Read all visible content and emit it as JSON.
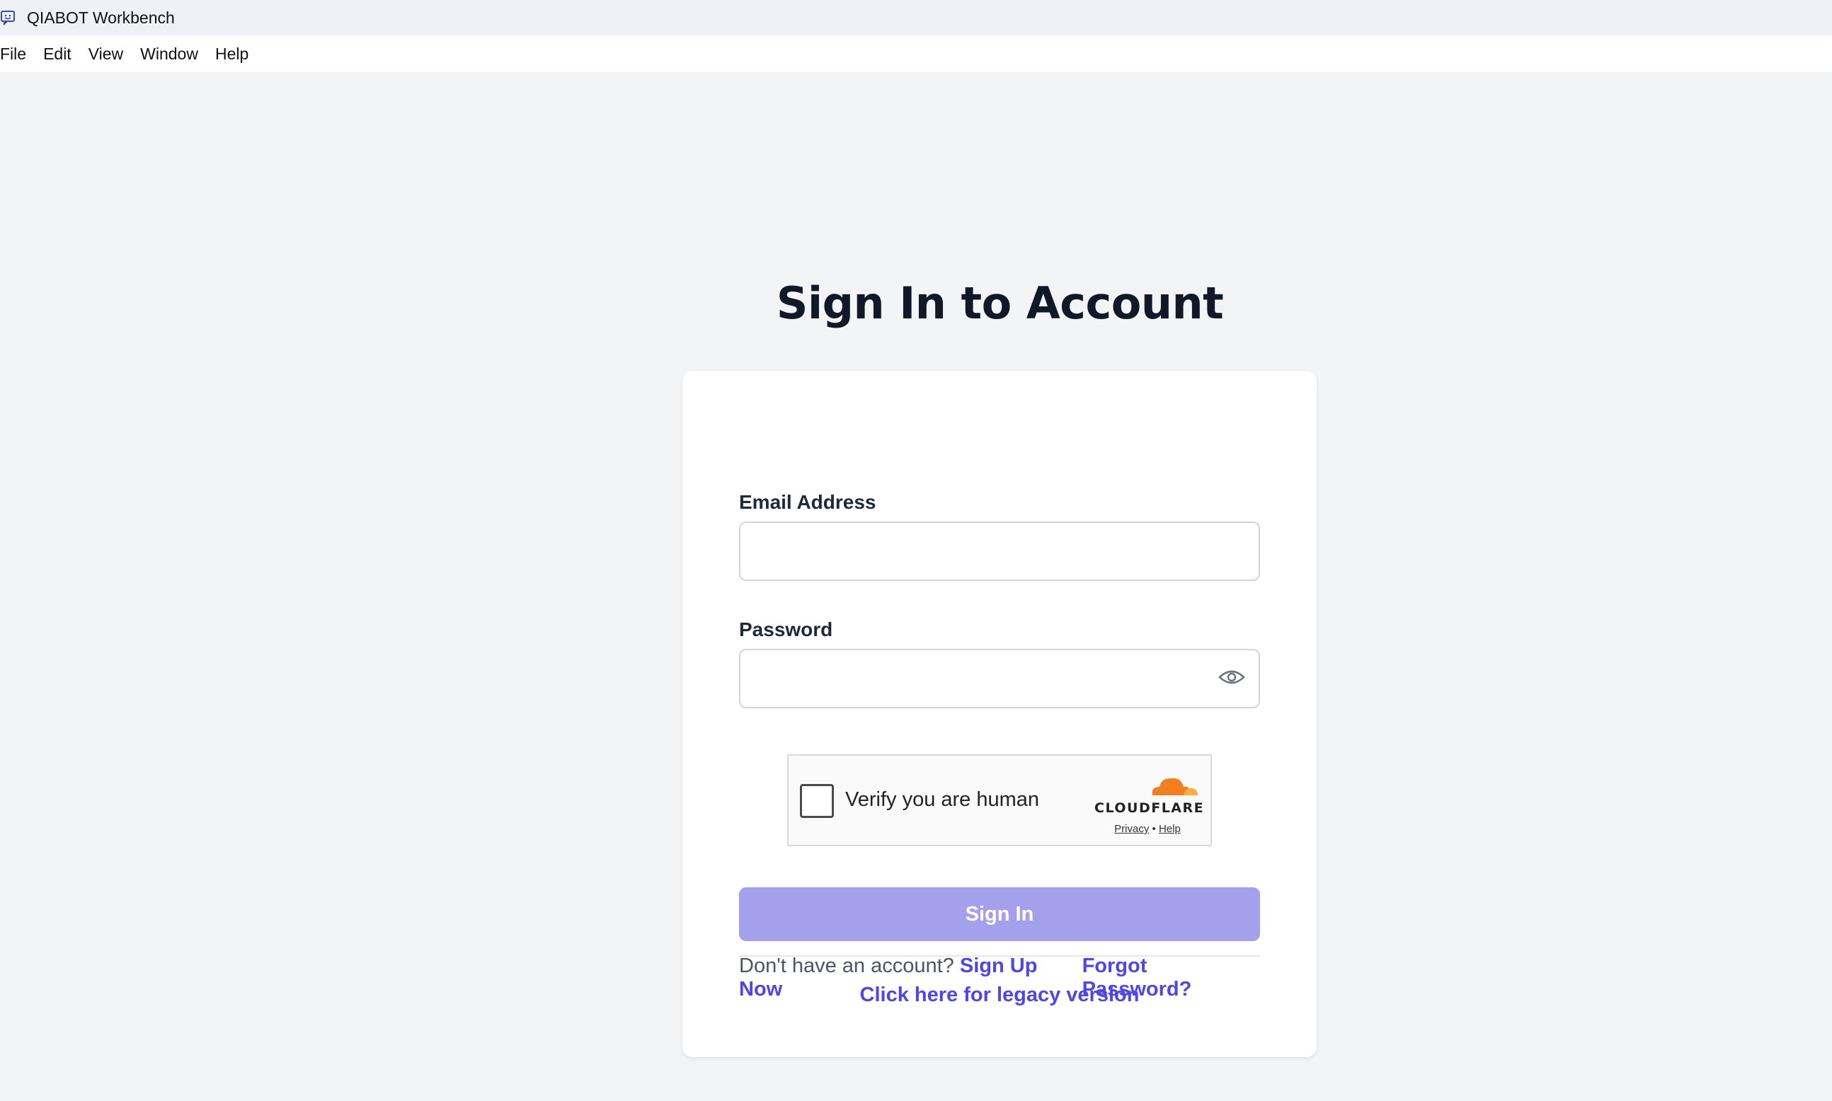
{
  "window": {
    "title": "QIABOT Workbench"
  },
  "menu": {
    "items": [
      "File",
      "Edit",
      "View",
      "Window",
      "Help"
    ]
  },
  "page": {
    "title": "Sign In to Account"
  },
  "form": {
    "email_label": "Email Address",
    "email_value": "",
    "password_label": "Password",
    "password_value": ""
  },
  "captcha": {
    "text": "Verify you are human",
    "brand": "CLOUDFLARE",
    "privacy": "Privacy",
    "separator": "•",
    "help": "Help",
    "checked": false
  },
  "actions": {
    "signin_label": "Sign In",
    "no_account_text": "Don't have an account?",
    "signup_label": "Sign Up Now",
    "forgot_label": "Forgot Password?",
    "legacy_label": "Click here for legacy version"
  },
  "colors": {
    "accent": "#4f46e5",
    "button_disabled": "#a5a0ec",
    "cloudflare_orange": "#f38020"
  }
}
